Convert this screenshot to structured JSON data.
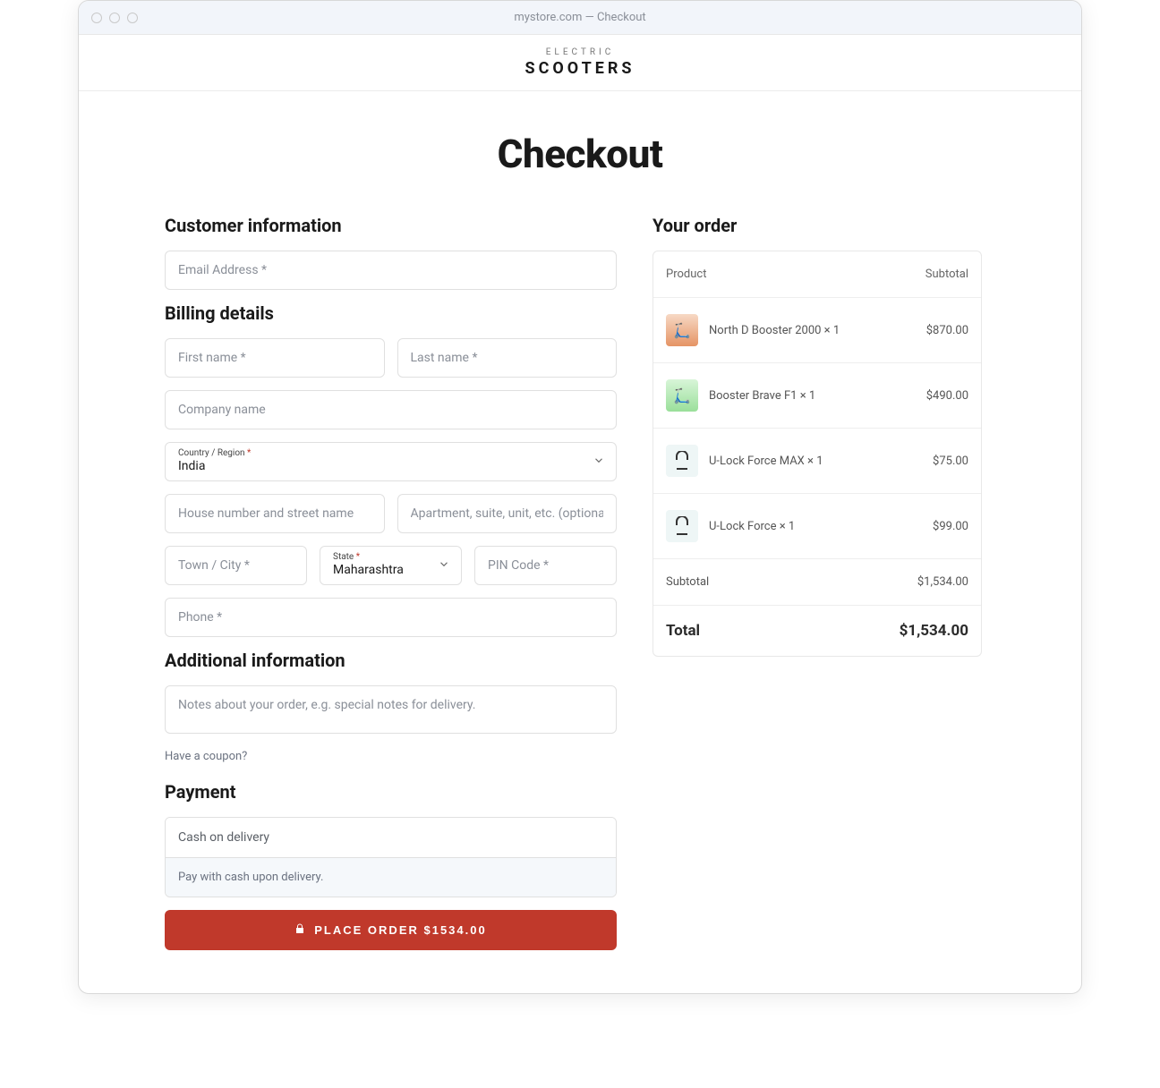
{
  "window_title": "mystore.com — Checkout",
  "brand": {
    "top": "ELECTRIC",
    "main": "SCOOTERS"
  },
  "page_title": "Checkout",
  "sections": {
    "customer": "Customer information",
    "billing": "Billing details",
    "additional": "Additional information",
    "payment": "Payment",
    "order": "Your order"
  },
  "placeholders": {
    "email": "Email Address *",
    "first": "First name *",
    "last": "Last name *",
    "company": "Company name",
    "street": "House number and street name",
    "apt": "Apartment, suite, unit, etc. (optional)",
    "city": "Town / City *",
    "pin": "PIN Code *",
    "phone": "Phone *",
    "notes": "Notes about your order, e.g. special notes for delivery."
  },
  "country": {
    "label": "Country / Region",
    "req": "*",
    "value": "India"
  },
  "state": {
    "label": "State",
    "req": "*",
    "value": "Maharashtra"
  },
  "coupon": "Have a coupon?",
  "payment": {
    "method": "Cash on delivery",
    "desc": "Pay with cash upon delivery."
  },
  "place_button": "PLACE ORDER $1534.00",
  "order": {
    "head_product": "Product",
    "head_subtotal": "Subtotal",
    "items": [
      {
        "name": "North D Booster 2000  × 1",
        "price": "$870.00",
        "thumb": "scoot-r"
      },
      {
        "name": "Booster Brave F1  × 1",
        "price": "$490.00",
        "thumb": "scoot-g"
      },
      {
        "name": "U-Lock Force MAX  × 1",
        "price": "$75.00",
        "thumb": "lock"
      },
      {
        "name": "U-Lock Force  × 1",
        "price": "$99.00",
        "thumb": "lock"
      }
    ],
    "subtotal_label": "Subtotal",
    "subtotal": "$1,534.00",
    "total_label": "Total",
    "total": "$1,534.00"
  }
}
